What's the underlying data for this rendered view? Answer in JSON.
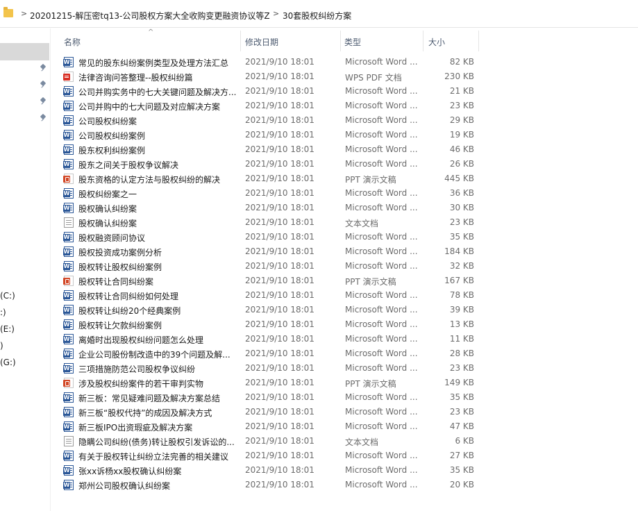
{
  "breadcrumb": {
    "parts": [
      "20201215-解压密tq13-公司股权方案大全收购变更融资协议等Z",
      "30套股权纠纷方案"
    ]
  },
  "nav": {
    "drives": [
      "(C:)",
      ":)",
      "(E:)",
      ")",
      "(G:)"
    ]
  },
  "columns": {
    "name": "名称",
    "date": "修改日期",
    "type": "类型",
    "size": "大小"
  },
  "files": [
    {
      "icon": "word-icon",
      "name": "常见的股东纠纷案例类型及处理方法汇总",
      "date": "2021/9/10 18:01",
      "type": "Microsoft Word ...",
      "size": "82 KB"
    },
    {
      "icon": "pdf-icon",
      "name": "法律咨询问答整理--股权纠纷篇",
      "date": "2021/9/10 18:01",
      "type": "WPS PDF 文档",
      "size": "230 KB"
    },
    {
      "icon": "word-icon",
      "name": "公司并购实务中的七大关键问题及解决方...",
      "date": "2021/9/10 18:01",
      "type": "Microsoft Word ...",
      "size": "21 KB"
    },
    {
      "icon": "word-icon",
      "name": "公司并购中的七大问题及对应解决方案",
      "date": "2021/9/10 18:01",
      "type": "Microsoft Word ...",
      "size": "23 KB"
    },
    {
      "icon": "word-icon",
      "name": "公司股权纠纷案",
      "date": "2021/9/10 18:01",
      "type": "Microsoft Word ...",
      "size": "29 KB"
    },
    {
      "icon": "word-icon",
      "name": "公司股权纠纷案例",
      "date": "2021/9/10 18:01",
      "type": "Microsoft Word ...",
      "size": "19 KB"
    },
    {
      "icon": "word-icon",
      "name": "股东权利纠纷案例",
      "date": "2021/9/10 18:01",
      "type": "Microsoft Word ...",
      "size": "46 KB"
    },
    {
      "icon": "word-icon",
      "name": "股东之间关于股权争议解决",
      "date": "2021/9/10 18:01",
      "type": "Microsoft Word ...",
      "size": "26 KB"
    },
    {
      "icon": "ppt-icon",
      "name": "股东资格的认定方法与股权纠纷的解决",
      "date": "2021/9/10 18:01",
      "type": "PPT 演示文稿",
      "size": "445 KB"
    },
    {
      "icon": "word-icon",
      "name": "股权纠纷案之一",
      "date": "2021/9/10 18:01",
      "type": "Microsoft Word ...",
      "size": "36 KB"
    },
    {
      "icon": "word-icon",
      "name": "股权确认纠纷案",
      "date": "2021/9/10 18:01",
      "type": "Microsoft Word ...",
      "size": "30 KB"
    },
    {
      "icon": "txt-icon",
      "name": "股权确认纠纷案",
      "date": "2021/9/10 18:01",
      "type": "文本文档",
      "size": "23 KB"
    },
    {
      "icon": "word-icon",
      "name": "股权融资顾问协议",
      "date": "2021/9/10 18:01",
      "type": "Microsoft Word ...",
      "size": "35 KB"
    },
    {
      "icon": "word-icon",
      "name": "股权投资成功案例分析",
      "date": "2021/9/10 18:01",
      "type": "Microsoft Word ...",
      "size": "184 KB"
    },
    {
      "icon": "word-icon",
      "name": "股权转让股权纠纷案例",
      "date": "2021/9/10 18:01",
      "type": "Microsoft Word ...",
      "size": "32 KB"
    },
    {
      "icon": "ppt-icon",
      "name": "股权转让合同纠纷案",
      "date": "2021/9/10 18:01",
      "type": "PPT 演示文稿",
      "size": "167 KB"
    },
    {
      "icon": "word-icon",
      "name": "股权转让合同纠纷如何处理",
      "date": "2021/9/10 18:01",
      "type": "Microsoft Word ...",
      "size": "78 KB"
    },
    {
      "icon": "word-icon",
      "name": "股权转让纠纷20个经典案例",
      "date": "2021/9/10 18:01",
      "type": "Microsoft Word ...",
      "size": "39 KB"
    },
    {
      "icon": "word-icon",
      "name": "股权转让欠款纠纷案例",
      "date": "2021/9/10 18:01",
      "type": "Microsoft Word ...",
      "size": "13 KB"
    },
    {
      "icon": "word-icon",
      "name": "离婚时出现股权纠纷问题怎么处理",
      "date": "2021/9/10 18:01",
      "type": "Microsoft Word ...",
      "size": "11 KB"
    },
    {
      "icon": "word-icon",
      "name": "企业公司股份制改造中的39个问题及解...",
      "date": "2021/9/10 18:01",
      "type": "Microsoft Word ...",
      "size": "28 KB"
    },
    {
      "icon": "word-icon",
      "name": "三项措施防范公司股权争议纠纷",
      "date": "2021/9/10 18:01",
      "type": "Microsoft Word ...",
      "size": "23 KB"
    },
    {
      "icon": "ppt-icon",
      "name": "涉及股权纠纷案件的若干审判实物",
      "date": "2021/9/10 18:01",
      "type": "PPT 演示文稿",
      "size": "149 KB"
    },
    {
      "icon": "word-icon",
      "name": "新三板：常见疑难问题及解决方案总结",
      "date": "2021/9/10 18:01",
      "type": "Microsoft Word ...",
      "size": "35 KB"
    },
    {
      "icon": "word-icon",
      "name": "新三板“股权代持”的成因及解决方式",
      "date": "2021/9/10 18:01",
      "type": "Microsoft Word ...",
      "size": "23 KB"
    },
    {
      "icon": "word-icon",
      "name": "新三板IPO出资瑕疵及解决方案",
      "date": "2021/9/10 18:01",
      "type": "Microsoft Word ...",
      "size": "47 KB"
    },
    {
      "icon": "txt-icon",
      "name": "隐瞒公司纠纷(债务)转让股权引发诉讼的...",
      "date": "2021/9/10 18:01",
      "type": "文本文档",
      "size": "6 KB"
    },
    {
      "icon": "word-icon",
      "name": "有关于股权转让纠纷立法完善的相关建议",
      "date": "2021/9/10 18:01",
      "type": "Microsoft Word ...",
      "size": "27 KB"
    },
    {
      "icon": "word-icon",
      "name": "张xx诉杨xx股权确认纠纷案",
      "date": "2021/9/10 18:01",
      "type": "Microsoft Word ...",
      "size": "35 KB"
    },
    {
      "icon": "word-icon",
      "name": "郑州公司股权确认纠纷案",
      "date": "2021/9/10 18:01",
      "type": "Microsoft Word ...",
      "size": "20 KB"
    }
  ]
}
